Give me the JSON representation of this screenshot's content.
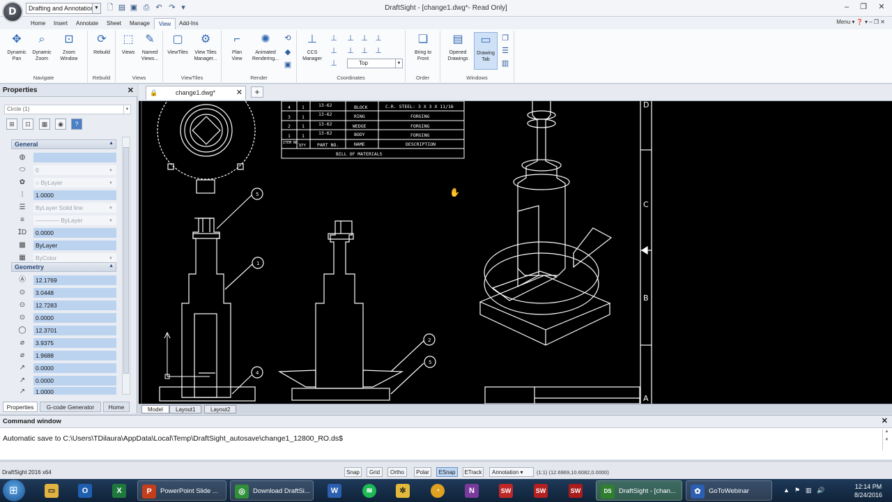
{
  "titlebar": {
    "workspace": "Drafting and Annotation",
    "window_title": "DraftSight - [change1.dwg*- Read Only]"
  },
  "ribbon_tabs": [
    "Home",
    "Insert",
    "Annotate",
    "Sheet",
    "Manage",
    "View",
    "Add-Ins"
  ],
  "ribbon_right": "Menu",
  "ribbon": {
    "navigate": {
      "label": "Navigate",
      "btn1": "Dynamic\nPan",
      "btn2": "Dynamic\nZoom",
      "btn3": "Zoom\nWindow"
    },
    "rebuild": {
      "label": "Rebuild",
      "btn1": "Rebuild"
    },
    "views": {
      "label": "Views",
      "btn1": "Views",
      "btn2": "Named\nViews..."
    },
    "viewtiles": {
      "label": "ViewTiles",
      "btn1": "ViewTiles",
      "btn2": "View Tiles\nManager..."
    },
    "render": {
      "label": "Render",
      "btn1": "Plan\nView",
      "btn2": "Animated\nRendering..."
    },
    "coordinates": {
      "label": "Coordinates",
      "btn1": "CCS\nManager",
      "view_select": "Top"
    },
    "order": {
      "label": "Order",
      "btn1": "Bring to\nFront"
    },
    "windows": {
      "label": "Windows",
      "btn1": "Opened\nDrawings",
      "btn2": "Drawing\nTab"
    }
  },
  "properties": {
    "title": "Properties",
    "entity": "Circle (1)",
    "general_label": "General",
    "geometry_label": "Geometry",
    "general": [
      "",
      "0",
      "ByLayer",
      "1.0000",
      "ByLayer    Solid line",
      "———— ByLayer",
      "0.0000",
      "ByLayer",
      "ByColor"
    ],
    "geometry": [
      "12.1769",
      "3.0448",
      "12.7283",
      "0.0000",
      "12.3701",
      "3.9375",
      "1.9688",
      "0.0000",
      "0.0000",
      "1.0000"
    ],
    "tabs": [
      "Properties",
      "G-code Generator",
      "Home"
    ]
  },
  "document": {
    "tab": "change1.dwg*"
  },
  "bom": {
    "rows": [
      [
        "4",
        "1",
        "13-62",
        "BLOCK",
        "C.R. STEEL: 3 X 3 X 11/16"
      ],
      [
        "3",
        "1",
        "13-62",
        "RING",
        "FORGING"
      ],
      [
        "2",
        "1",
        "13-62",
        "WEDGE",
        "FORGING"
      ],
      [
        "1",
        "1",
        "13-62",
        "BODY",
        "FORGING"
      ]
    ],
    "header": [
      "ITEM NO.",
      "QTY",
      "PART NO.",
      "NAME",
      "DESCRIPTION"
    ],
    "footer": "BILL OF MATERIALS"
  },
  "zone_labels": [
    "D",
    "C",
    "B",
    "A"
  ],
  "balloons": [
    "5",
    "1",
    "4",
    "2",
    "5"
  ],
  "layouts": [
    "Model",
    "Layout1",
    "Layout2"
  ],
  "command": {
    "title": "Command window",
    "line": "Automatic save to C:\\Users\\TDilaura\\AppData\\Local\\Temp\\DraftSight_autosave\\change1_12800_RO.ds$"
  },
  "status": {
    "app": "DraftSight 2016 x64",
    "buttons": [
      "Snap",
      "Grid",
      "Ortho",
      "Polar",
      "ESnap",
      "ETrack"
    ],
    "annotation": "Annotation",
    "scale": "(1:1)",
    "coords": "(12.6969,10.6082,0.0000)"
  },
  "taskbar": {
    "items": [
      {
        "label": "PowerPoint Slide ...",
        "icon": "P",
        "color": "#c43e1c"
      },
      {
        "label": "Download DraftSi...",
        "icon": "◎",
        "color": "#2f8f3a"
      },
      {
        "label": "DraftSight - [chan...",
        "icon": "DS",
        "color": "#2f7f2f"
      },
      {
        "label": "GoToWebinar",
        "icon": "✿",
        "color": "#2c5fb3"
      }
    ],
    "time": "12:14 PM",
    "date": "8/24/2016"
  },
  "colors": {
    "canvas": "#000000",
    "accent": "#2f68b3",
    "selection": "#bcd3f0"
  }
}
